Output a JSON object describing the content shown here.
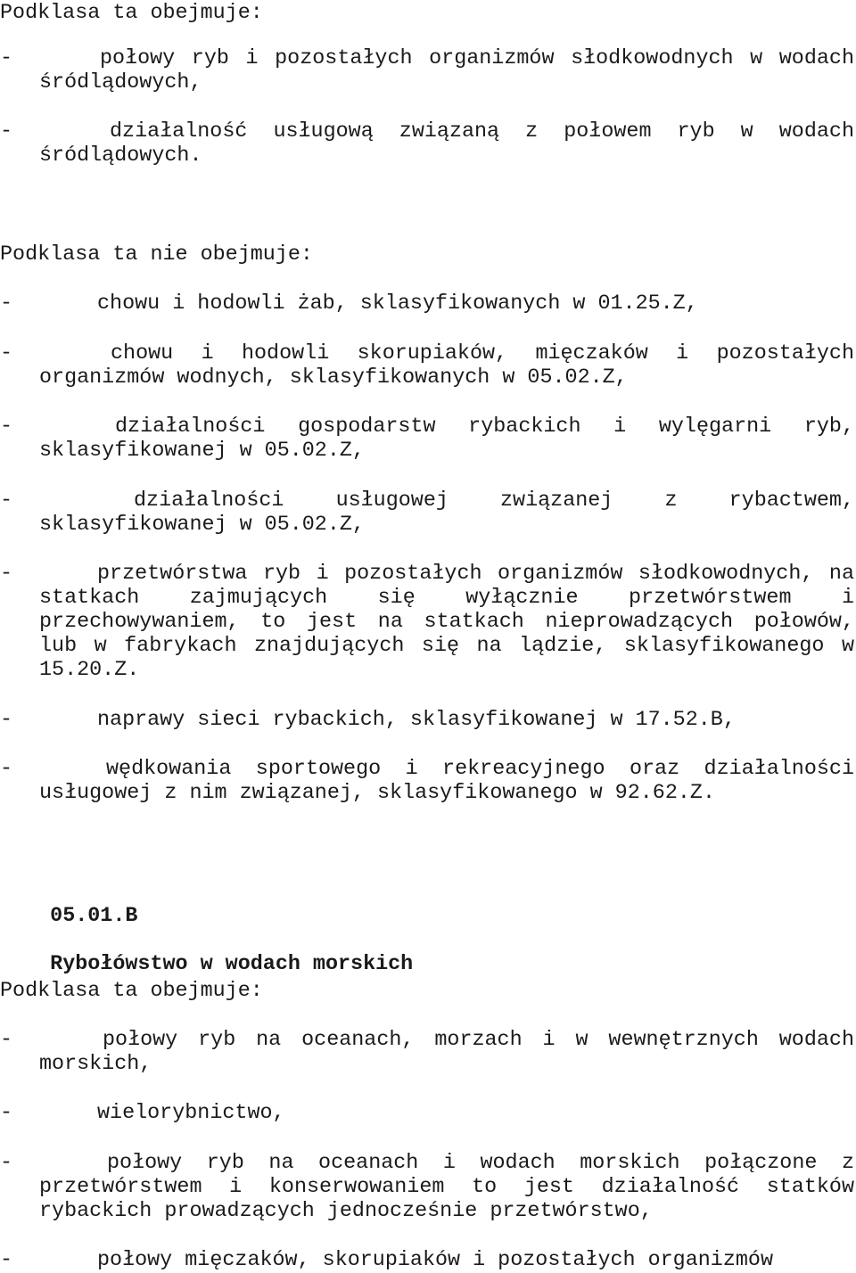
{
  "sections": [
    {
      "intro_label": "Podklasa ta obejmuje:",
      "items": [
        {
          "lines": [
            "połowy ryb i pozostałych organizmów słodkowodnych w wodach",
            "śródlądowych,"
          ]
        },
        {
          "lines": [
            "działalność usługową związaną z połowem ryb w wodach",
            "śródlądowych."
          ]
        }
      ]
    },
    {
      "intro_label": "Podklasa ta nie obejmuje:",
      "items": [
        {
          "lines": [
            "chowu i hodowli żab, sklasyfikowanych w 01.25.Z,"
          ]
        },
        {
          "lines": [
            "chowu i hodowli skorupiaków, mięczaków i pozostałych",
            "organizmów wodnych, sklasyfikowanych w 05.02.Z,"
          ]
        },
        {
          "lines": [
            "działalności gospodarstw rybackich i wylęgarni ryb,",
            "sklasyfikowanej w 05.02.Z,"
          ]
        },
        {
          "lines": [
            "działalności usługowej związanej z rybactwem,",
            "sklasyfikowanej w 05.02.Z,"
          ]
        },
        {
          "lines": [
            "przetwórstwa ryb i pozostałych organizmów słodkowodnych, na",
            "statkach zajmujących się wyłącznie przetwórstwem i",
            "przechowywaniem, to jest na statkach nieprowadzących połowów,",
            "lub w fabrykach znajdujących się na lądzie, sklasyfikowanego w",
            "15.20.Z."
          ]
        },
        {
          "lines": [
            "naprawy sieci rybackich, sklasyfikowanej w 17.52.B,"
          ]
        },
        {
          "lines": [
            "wędkowania sportowego i rekreacyjnego oraz działalności",
            "usługowej z nim związanej, sklasyfikowanego w 92.62.Z."
          ]
        }
      ]
    },
    {
      "heading": {
        "code": "05.01.B",
        "title": "Rybołówstwo w wodach morskich"
      }
    },
    {
      "intro_label": "Podklasa ta obejmuje:",
      "items": [
        {
          "lines": [
            "połowy ryb na oceanach, morzach i w wewnętrznych wodach",
            "morskich,"
          ]
        },
        {
          "lines": [
            "wielorybnictwo,"
          ]
        },
        {
          "lines": [
            "połowy ryb na oceanach i wodach morskich połączone z",
            "przetwórstwem i konserwowaniem to jest działalność statków",
            "rybackich prowadzących jednocześnie przetwórstwo,"
          ]
        },
        {
          "lines": [
            "połowy mięczaków, skorupiaków i pozostałych organizmów"
          ]
        }
      ]
    }
  ],
  "bullet": "-"
}
